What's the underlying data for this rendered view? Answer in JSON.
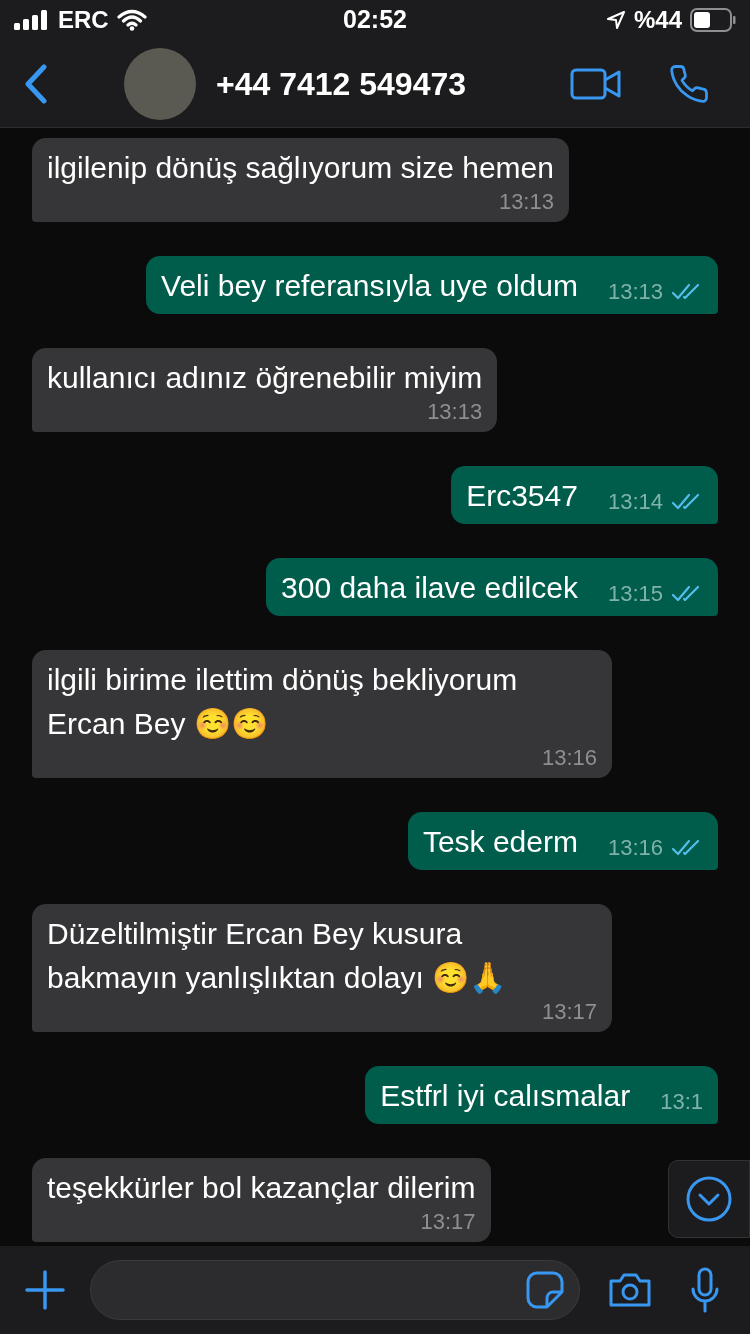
{
  "status_bar": {
    "carrier": "ERC",
    "time": "02:52",
    "battery": "%44"
  },
  "header": {
    "title": "+44 7412 549473"
  },
  "messages": [
    {
      "kind": "incoming",
      "text": "ilgilenip dönüş sağlıyorum size hemen",
      "time": "13:13"
    },
    {
      "kind": "outgoing",
      "text": "Veli bey referansıyla uye oldum",
      "time": "13:13",
      "read": true
    },
    {
      "kind": "incoming",
      "text": "kullanıcı adınız öğrenebilir miyim",
      "time": "13:13"
    },
    {
      "kind": "outgoing",
      "text": "Erc3547",
      "time": "13:14",
      "read": true
    },
    {
      "kind": "outgoing",
      "text": "300 daha ilave edilcek",
      "time": "13:15",
      "read": true
    },
    {
      "kind": "incoming",
      "text": "ilgili birime ilettim dönüş bekliyorum Ercan Bey ☺️☺️",
      "time": "13:16"
    },
    {
      "kind": "outgoing",
      "text": "Tesk ederm",
      "time": "13:16",
      "read": true
    },
    {
      "kind": "incoming",
      "text": "Düzeltilmiştir Ercan Bey kusura bakmayın yanlışlıktan dolayı ☺️🙏",
      "time": "13:17"
    },
    {
      "kind": "outgoing",
      "text": "Estfrl iyi calısmalar",
      "time": "13:1"
    },
    {
      "kind": "incoming",
      "text": "teşekkürler bol kazançlar dilerim",
      "time": "13:17"
    }
  ]
}
